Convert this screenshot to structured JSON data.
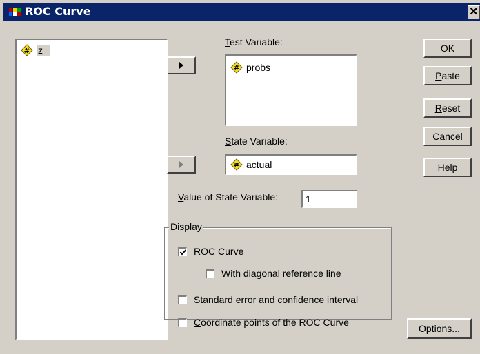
{
  "title": "ROC Curve",
  "source_list": {
    "items": [
      {
        "name": "z",
        "icon": "numeric-scale-icon"
      }
    ]
  },
  "test_variable": {
    "label_pre": "",
    "label_key": "T",
    "label_post": "est Variable:",
    "items": [
      {
        "name": "probs",
        "icon": "numeric-scale-icon"
      }
    ]
  },
  "state_variable": {
    "label_key": "S",
    "label_post": "tate Variable:",
    "value": "actual",
    "icon": "numeric-scale-icon"
  },
  "value_of_state": {
    "label_key": "V",
    "label_post": "alue of State Variable:",
    "value": "1"
  },
  "buttons": {
    "ok": "OK",
    "paste_key": "P",
    "paste_post": "aste",
    "reset_key": "R",
    "reset_post": "eset",
    "cancel": "Cancel",
    "help": "Help",
    "options_key": "O",
    "options_post": "ptions..."
  },
  "display": {
    "legend": "Display",
    "roc_curve": {
      "pre": "ROC C",
      "key": "u",
      "post": "rve",
      "checked": true
    },
    "diagonal": {
      "pre": "",
      "key": "W",
      "post": "ith diagonal reference line",
      "checked": false
    },
    "std_error": {
      "pre": "Standard ",
      "key": "e",
      "post": "rror and confidence interval",
      "checked": false
    },
    "coord_points": {
      "pre": "",
      "key": "C",
      "post": "oordinate points of the ROC Curve",
      "checked": false
    }
  },
  "colors": {
    "titlebar": "#0a246a",
    "dialog_bg": "#d4d0c8",
    "icon_yellow": "#f0e020"
  }
}
